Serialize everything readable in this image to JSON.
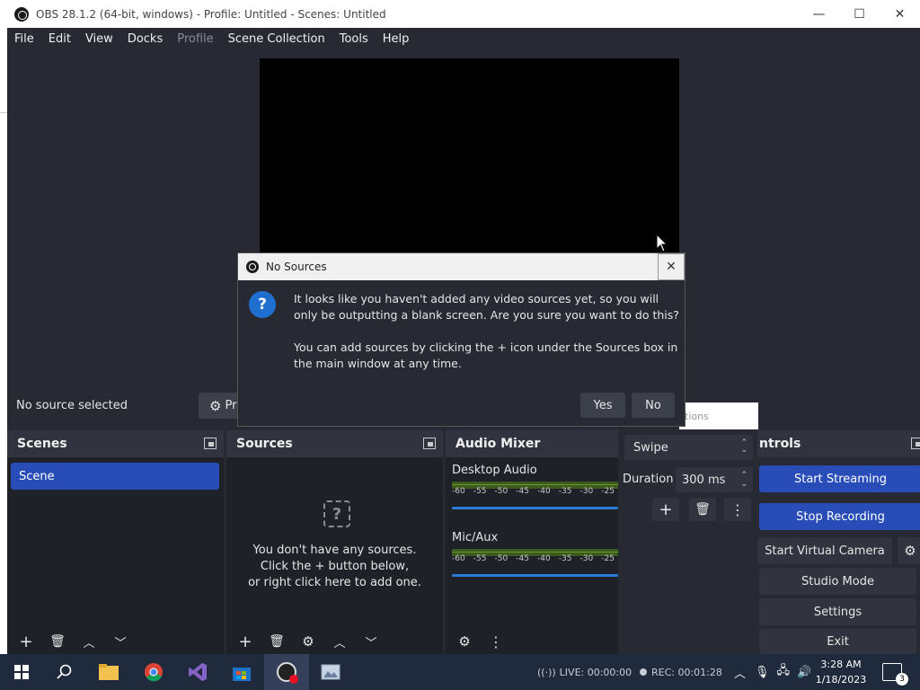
{
  "window": {
    "title": "OBS 28.1.2 (64-bit, windows) - Profile: Untitled - Scenes: Untitled",
    "minimize": "—",
    "maximize": "☐",
    "close": "✕"
  },
  "menu": [
    "File",
    "Edit",
    "View",
    "Docks",
    "Profile",
    "Scene Collection",
    "Tools",
    "Help"
  ],
  "source_bar": {
    "no_source": "No source selected",
    "properties": "Pr",
    "transitions_hint": "tions"
  },
  "scenes": {
    "title": "Scenes",
    "items": [
      "Scene"
    ]
  },
  "sources": {
    "title": "Sources",
    "empty_line1": "You don't have any sources.",
    "empty_line2": "Click the + button below,",
    "empty_line3": "or right click here to add one."
  },
  "mixer": {
    "title": "Audio Mixer",
    "channels": [
      {
        "name": "Desktop Audio",
        "volume": 1.0
      },
      {
        "name": "Mic/Aux",
        "volume": 1.0
      }
    ],
    "ticks": [
      "-60",
      "-55",
      "-50",
      "-45",
      "-40",
      "-35",
      "-30",
      "-25"
    ]
  },
  "transitions": {
    "selected": "Swipe",
    "duration_label": "Duration",
    "duration_value": "300 ms"
  },
  "controls": {
    "title": "ntrols",
    "start_streaming": "Start Streaming",
    "stop_recording": "Stop Recording",
    "start_virtual_camera": "Start Virtual Camera",
    "studio_mode": "Studio Mode",
    "settings": "Settings",
    "exit": "Exit"
  },
  "dialog": {
    "title": "No Sources",
    "message1": "It looks like you haven't added any video sources yet, so you will only be outputting a blank screen. Are you sure you want to do this?",
    "message2": "You can add sources by clicking the + icon under the Sources box in the main window at any time.",
    "yes": "Yes",
    "no": "No"
  },
  "taskbar": {
    "live": "LIVE: 00:00:00",
    "rec": "REC: 00:01:28",
    "time": "3:28 AM",
    "date": "1/18/2023",
    "notifications": "3"
  },
  "colors": {
    "window_bg": "#272a33",
    "dock_bg": "#1f2128",
    "accent": "#284cb8",
    "taskbar": "#1f2a3d"
  }
}
